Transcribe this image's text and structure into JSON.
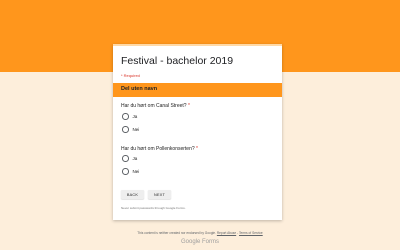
{
  "form": {
    "title": "Festival - bachelor 2019",
    "required_note": "* Required",
    "section_title": "Del uten navn",
    "questions": [
      {
        "label": "Har du hørt om Canal Street?",
        "required_mark": "*",
        "options": [
          "Ja",
          "Nei"
        ]
      },
      {
        "label": "Har du hørt om Pollenkonserten?",
        "required_mark": "*",
        "options": [
          "Ja",
          "Nei"
        ]
      }
    ],
    "buttons": {
      "back": "BACK",
      "next": "NEXT"
    },
    "password_note": "Never submit passwords through Google Forms."
  },
  "footer": {
    "disclaimer_text": "This content is neither created nor endorsed by Google.",
    "report_abuse": "Report Abuse",
    "separator": "-",
    "terms": "Terms of Service",
    "brand": "Google Forms"
  },
  "colors": {
    "accent": "#ff961c",
    "background": "#fdeedb",
    "required": "#d93025"
  }
}
